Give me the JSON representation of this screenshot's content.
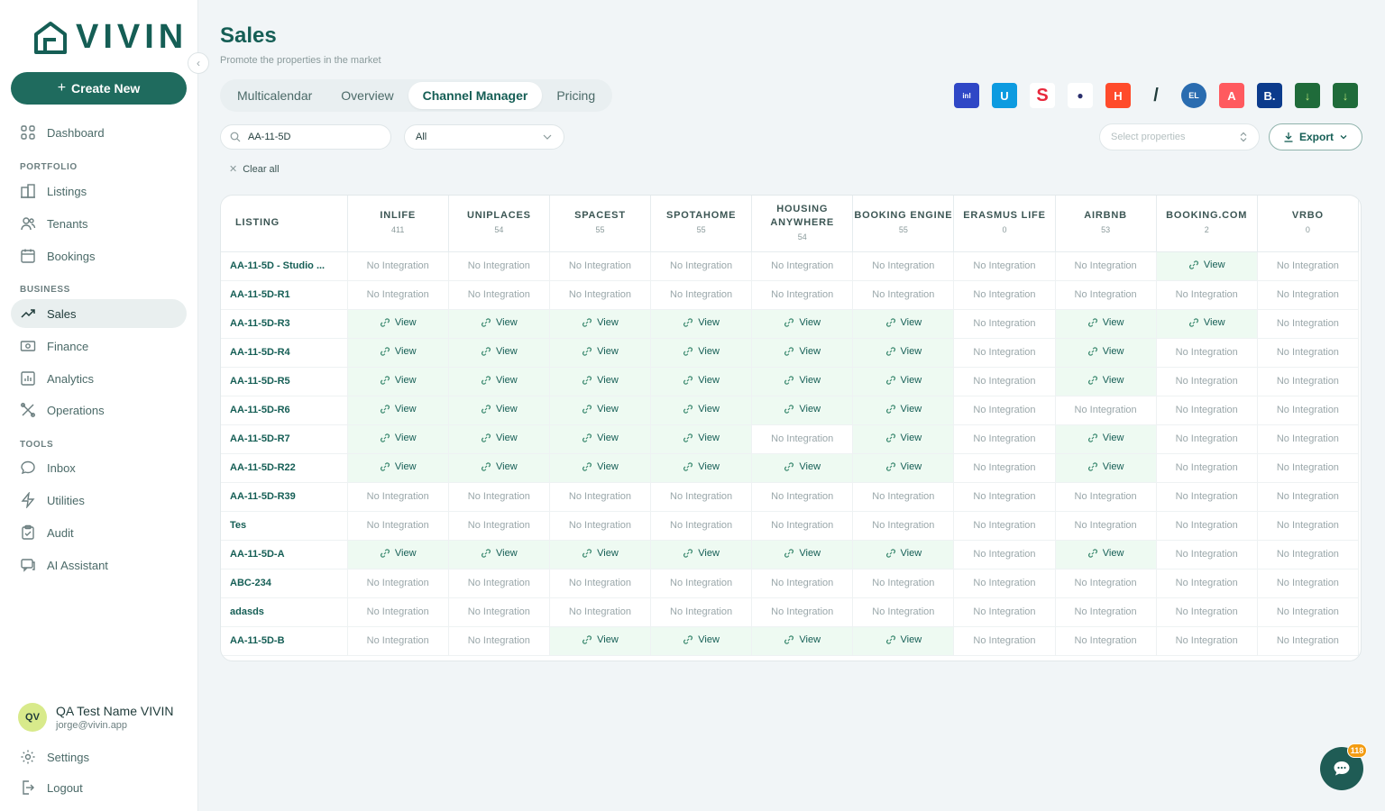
{
  "brand": {
    "name": "VIVIN"
  },
  "sidebar": {
    "create_label": "Create New",
    "dashboard": "Dashboard",
    "sections": {
      "portfolio": "PORTFOLIO",
      "business": "BUSINESS",
      "tools": "TOOLS"
    },
    "portfolio_items": [
      "Listings",
      "Tenants",
      "Bookings"
    ],
    "business_items": [
      "Sales",
      "Finance",
      "Analytics",
      "Operations"
    ],
    "tools_items": [
      "Inbox",
      "Utilities",
      "Audit",
      "AI Assistant"
    ],
    "active": "Sales"
  },
  "user": {
    "initials": "QV",
    "name": "QA Test Name VIVIN",
    "email": "jorge@vivin.app"
  },
  "footer": {
    "settings": "Settings",
    "logout": "Logout"
  },
  "page": {
    "title": "Sales",
    "subtitle": "Promote the properties in the market"
  },
  "tabs": [
    "Multicalendar",
    "Overview",
    "Channel Manager",
    "Pricing"
  ],
  "active_tab": "Channel Manager",
  "filters": {
    "search_value": "AA-11-5D",
    "status_select": "All",
    "clear_all": "Clear all",
    "select_properties_placeholder": "Select properties",
    "export_label": "Export"
  },
  "table": {
    "listing_header": "LISTING",
    "columns": [
      {
        "name": "INLIFE",
        "count": "411"
      },
      {
        "name": "UNIPLACES",
        "count": "54"
      },
      {
        "name": "SPACEST",
        "count": "55"
      },
      {
        "name": "SPOTAHOME",
        "count": "55"
      },
      {
        "name": "HOUSING ANYWHERE",
        "count": "54"
      },
      {
        "name": "BOOKING ENGINE",
        "count": "55"
      },
      {
        "name": "ERASMUS LIFE",
        "count": "0"
      },
      {
        "name": "AIRBNB",
        "count": "53"
      },
      {
        "name": "BOOKING.COM",
        "count": "2"
      },
      {
        "name": "VRBO",
        "count": "0"
      }
    ],
    "view_label": "View",
    "no_integration_label": "No Integration",
    "rows": [
      {
        "listing": "AA-11-5D - Studio ...",
        "cells": [
          0,
          0,
          0,
          0,
          0,
          0,
          0,
          0,
          1,
          0
        ]
      },
      {
        "listing": "AA-11-5D-R1",
        "cells": [
          0,
          0,
          0,
          0,
          0,
          0,
          0,
          0,
          0,
          0
        ]
      },
      {
        "listing": "AA-11-5D-R3",
        "cells": [
          1,
          1,
          1,
          1,
          1,
          1,
          0,
          1,
          1,
          0
        ]
      },
      {
        "listing": "AA-11-5D-R4",
        "cells": [
          1,
          1,
          1,
          1,
          1,
          1,
          0,
          1,
          0,
          0
        ]
      },
      {
        "listing": "AA-11-5D-R5",
        "cells": [
          1,
          1,
          1,
          1,
          1,
          1,
          0,
          1,
          0,
          0
        ]
      },
      {
        "listing": "AA-11-5D-R6",
        "cells": [
          1,
          1,
          1,
          1,
          1,
          1,
          0,
          0,
          0,
          0
        ]
      },
      {
        "listing": "AA-11-5D-R7",
        "cells": [
          1,
          1,
          1,
          1,
          0,
          1,
          0,
          1,
          0,
          0
        ]
      },
      {
        "listing": "AA-11-5D-R22",
        "cells": [
          1,
          1,
          1,
          1,
          1,
          1,
          0,
          1,
          0,
          0
        ]
      },
      {
        "listing": "AA-11-5D-R39",
        "cells": [
          0,
          0,
          0,
          0,
          0,
          0,
          0,
          0,
          0,
          0
        ]
      },
      {
        "listing": "Tes",
        "cells": [
          0,
          0,
          0,
          0,
          0,
          0,
          0,
          0,
          0,
          0
        ]
      },
      {
        "listing": "AA-11-5D-A",
        "cells": [
          1,
          1,
          1,
          1,
          1,
          1,
          0,
          1,
          0,
          0
        ]
      },
      {
        "listing": "ABC-234",
        "cells": [
          0,
          0,
          0,
          0,
          0,
          0,
          0,
          0,
          0,
          0
        ]
      },
      {
        "listing": "adasds",
        "cells": [
          0,
          0,
          0,
          0,
          0,
          0,
          0,
          0,
          0,
          0
        ]
      },
      {
        "listing": "AA-11-5D-B",
        "cells": [
          0,
          0,
          1,
          1,
          1,
          1,
          0,
          0,
          0,
          0
        ]
      }
    ]
  },
  "channel_icons": [
    {
      "name": "inlife",
      "color": "#2f47c6",
      "glyph": "inl"
    },
    {
      "name": "uniplaces",
      "color": "#0d9be0",
      "glyph": "U"
    },
    {
      "name": "spacest",
      "color": "#ffffff",
      "glyph": "S"
    },
    {
      "name": "spotahome",
      "color": "#ffffff",
      "glyph": "●"
    },
    {
      "name": "housing-anywhere",
      "color": "#ff4b2b",
      "glyph": "H"
    },
    {
      "name": "booking-engine",
      "color": "#ffffff",
      "glyph": "/"
    },
    {
      "name": "erasmus-life",
      "color": "#2a6cb0",
      "glyph": "EL"
    },
    {
      "name": "airbnb",
      "color": "#ff5a5f",
      "glyph": "A"
    },
    {
      "name": "booking-com",
      "color": "#0c3b8c",
      "glyph": "B."
    },
    {
      "name": "download-1",
      "color": "#1f6b3a",
      "glyph": "↓"
    },
    {
      "name": "download-2",
      "color": "#1f6b3a",
      "glyph": "↓"
    }
  ],
  "chat": {
    "badge": "118"
  }
}
